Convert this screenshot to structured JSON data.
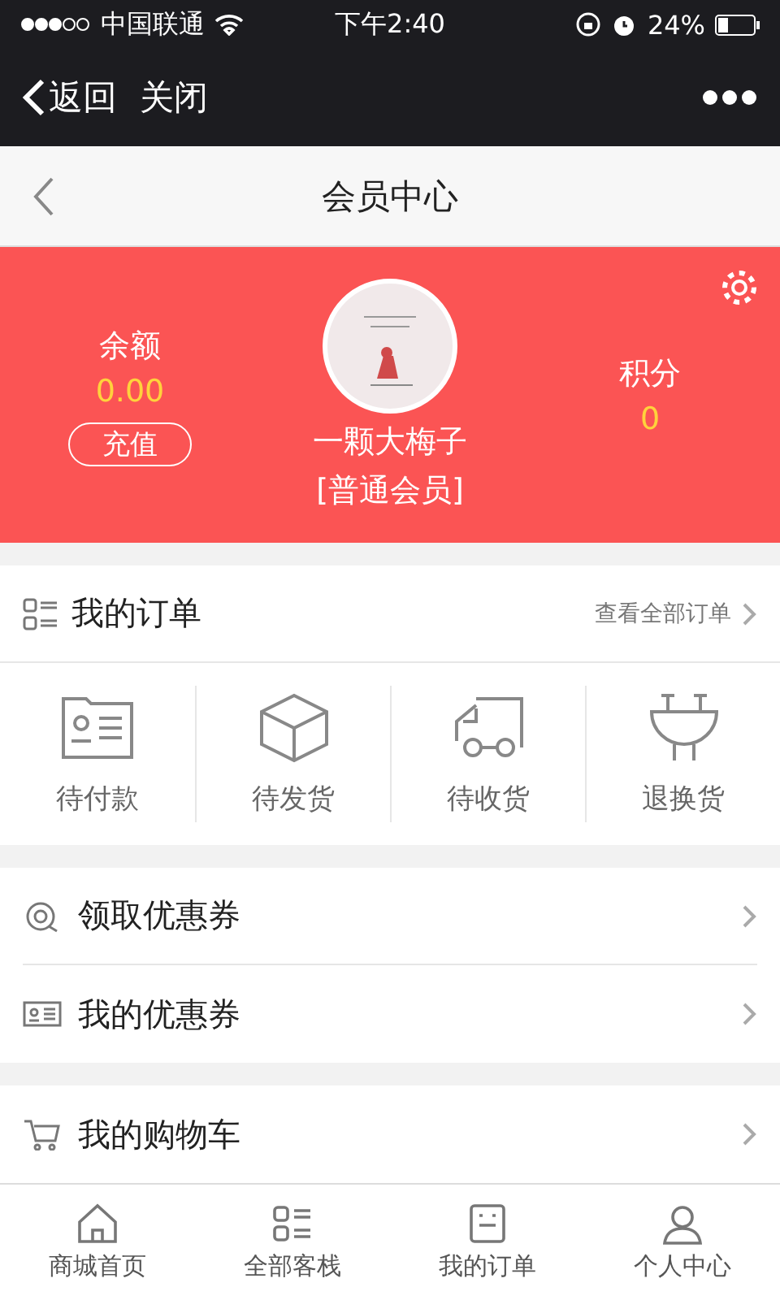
{
  "status_bar": {
    "carrier": "中国联通",
    "time": "下午2:40",
    "battery": "24%"
  },
  "nav": {
    "back": "返回",
    "close": "关闭"
  },
  "header": {
    "title": "会员中心"
  },
  "profile": {
    "balance_label": "余额",
    "balance": "0.00",
    "recharge": "充值",
    "name": "一颗大梅子",
    "level": "[普通会员]",
    "points_label": "积分",
    "points": "0"
  },
  "orders": {
    "title": "我的订单",
    "view_all": "查看全部订单",
    "items": [
      {
        "kind": "card",
        "label": "待付款"
      },
      {
        "kind": "box",
        "label": "待发货"
      },
      {
        "kind": "truck",
        "label": "待收货"
      },
      {
        "kind": "plug",
        "label": "退换货"
      }
    ]
  },
  "menu_groups": [
    [
      {
        "kind": "coupon-search",
        "label": "领取优惠券"
      },
      {
        "kind": "card",
        "label": "我的优惠券"
      }
    ],
    [
      {
        "kind": "cart",
        "label": "我的购物车"
      }
    ]
  ],
  "tab_bar": [
    {
      "kind": "home",
      "label": "商城首页",
      "selected": false
    },
    {
      "kind": "grid",
      "label": "全部客栈",
      "selected": false
    },
    {
      "kind": "order",
      "label": "我的订单",
      "selected": false
    },
    {
      "kind": "person",
      "label": "个人中心",
      "selected": false
    }
  ]
}
